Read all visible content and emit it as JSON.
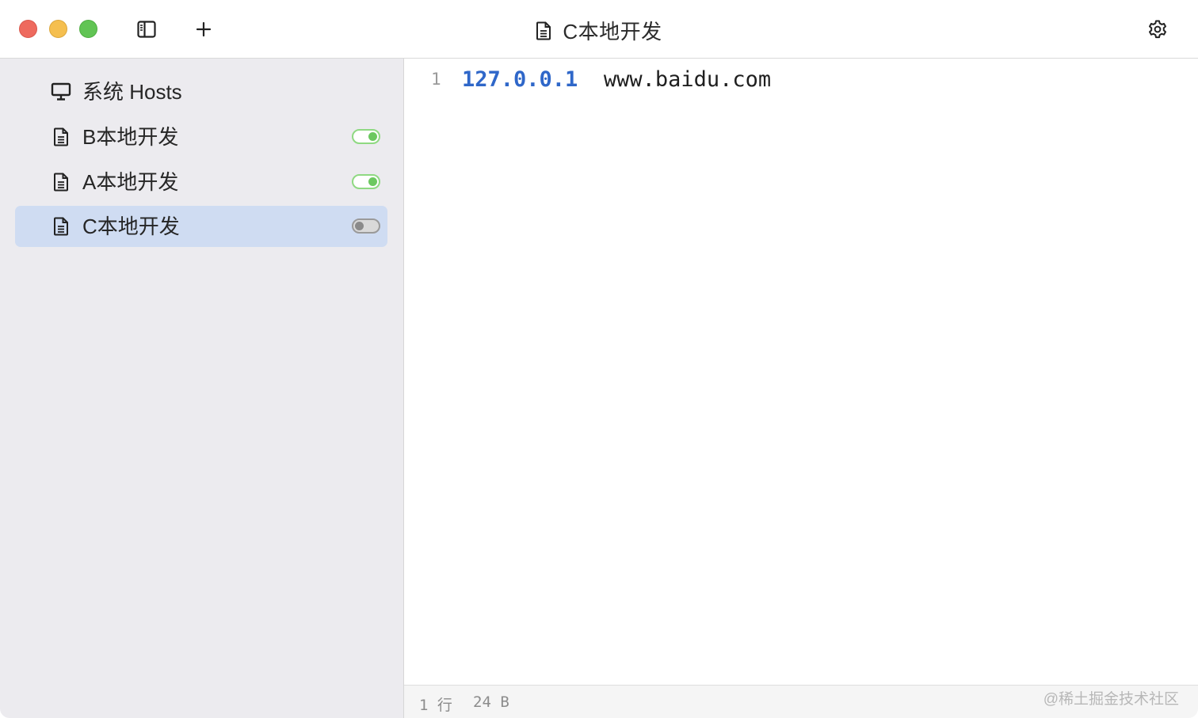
{
  "window": {
    "title": "C本地开发"
  },
  "sidebar": {
    "items": [
      {
        "label": "系统 Hosts",
        "icon": "monitor-icon",
        "has_toggle": false,
        "selected": false
      },
      {
        "label": "B本地开发",
        "icon": "document-icon",
        "has_toggle": true,
        "enabled": true,
        "selected": false
      },
      {
        "label": "A本地开发",
        "icon": "document-icon",
        "has_toggle": true,
        "enabled": true,
        "selected": false
      },
      {
        "label": "C本地开发",
        "icon": "document-icon",
        "has_toggle": true,
        "enabled": false,
        "selected": true
      }
    ]
  },
  "editor": {
    "lines": [
      {
        "number": "1",
        "ip": "127.0.0.1",
        "host": "www.baidu.com"
      }
    ]
  },
  "status": {
    "lines": "1 行",
    "size": "24 B"
  },
  "watermark": "@稀土掘金技术社区",
  "colors": {
    "accent_ip": "#2f67c9",
    "selected_bg": "#cfdcf2",
    "toggle_on": "#6cc860",
    "sidebar_bg": "#ecebef"
  }
}
